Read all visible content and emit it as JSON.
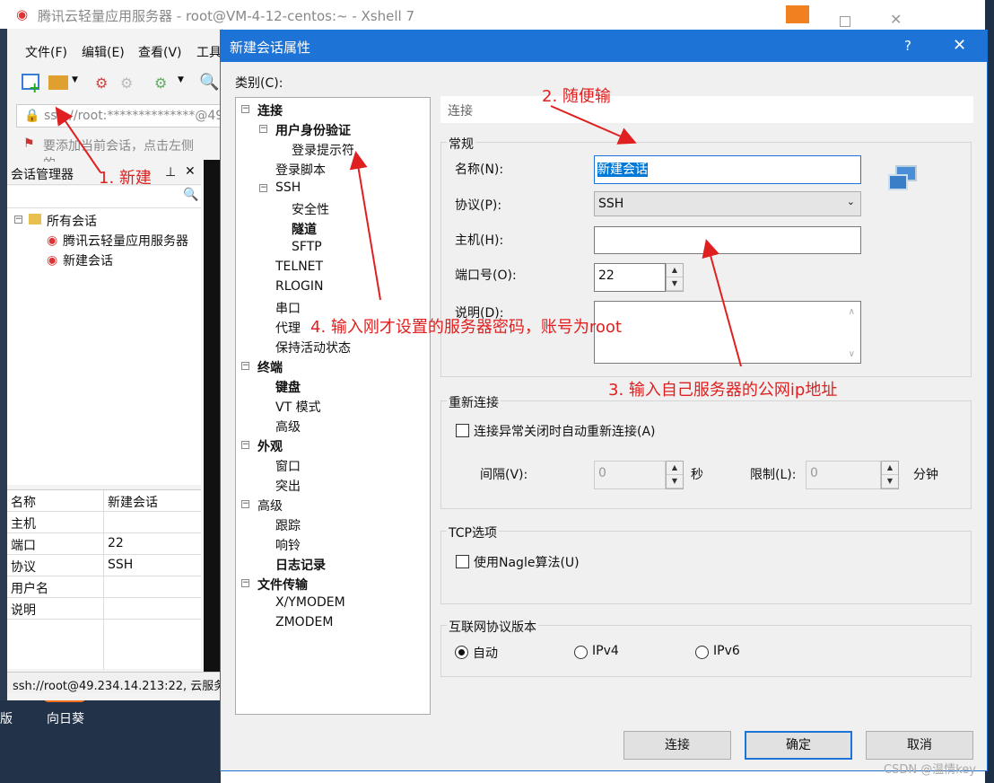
{
  "xshell": {
    "title": "腾讯云轻量应用服务器 - root@VM-4-12-centos:~ - Xshell 7",
    "menu": [
      "文件(F)",
      "编辑(E)",
      "查看(V)",
      "工具"
    ],
    "address": "ssh://root:**************@49",
    "tip": "要添加当前会话，点击左侧的",
    "session_manager": {
      "title": "会话管理器",
      "tree": {
        "root": "所有会话",
        "items": [
          "腾讯云轻量应用服务器",
          "新建会话"
        ]
      },
      "properties": [
        {
          "key": "名称",
          "value": "新建会话"
        },
        {
          "key": "主机",
          "value": ""
        },
        {
          "key": "端口",
          "value": "22"
        },
        {
          "key": "协议",
          "value": "SSH"
        },
        {
          "key": "用户名",
          "value": ""
        },
        {
          "key": "说明",
          "value": ""
        }
      ]
    },
    "status": "ssh://root@49.234.14.213:22, 云服务"
  },
  "desktop": {
    "icon_label_1": "版",
    "icon_label_2": "向日葵"
  },
  "dialog": {
    "title": "新建会话属性",
    "help": "?",
    "category_label": "类别(C):",
    "tree": {
      "connect": "连接",
      "auth": "用户身份验证",
      "login_prompt": "登录提示符",
      "login_script": "登录脚本",
      "ssh": "SSH",
      "security": "安全性",
      "tunnel": "隧道",
      "sftp": "SFTP",
      "telnet": "TELNET",
      "rlogin": "RLOGIN",
      "serial": "串口",
      "proxy": "代理",
      "keepalive": "保持活动状态",
      "terminal": "终端",
      "keyboard": "键盘",
      "vt_mode": "VT 模式",
      "advanced1": "高级",
      "appearance": "外观",
      "window": "窗口",
      "highlight": "突出",
      "advanced": "高级",
      "trace": "跟踪",
      "bell": "响铃",
      "logging": "日志记录",
      "file_transfer": "文件传输",
      "xymodem": "X/YMODEM",
      "zmodem": "ZMODEM"
    },
    "section_header": "连接",
    "general": {
      "label": "常规",
      "name_label": "名称(N):",
      "name_value": "新建会话",
      "protocol_label": "协议(P):",
      "protocol_value": "SSH",
      "host_label": "主机(H):",
      "host_value": "",
      "port_label": "端口号(O):",
      "port_value": "22",
      "desc_label": "说明(D):"
    },
    "reconnect": {
      "label": "重新连接",
      "checkbox": "连接异常关闭时自动重新连接(A)",
      "interval_label": "间隔(V):",
      "interval_value": "0",
      "interval_unit": "秒",
      "limit_label": "限制(L):",
      "limit_value": "0",
      "limit_unit": "分钟"
    },
    "tcp": {
      "label": "TCP选项",
      "checkbox": "使用Nagle算法(U)"
    },
    "ip_version": {
      "label": "互联网协议版本",
      "options": [
        "自动",
        "IPv4",
        "IPv6"
      ],
      "selected": "自动"
    },
    "buttons": {
      "connect": "连接",
      "ok": "确定",
      "cancel": "取消"
    }
  },
  "annotations": {
    "a1": "1. 新建",
    "a2": "2. 随便输",
    "a3": "3. 输入自己服务器的公网ip地址",
    "a4": "4. 输入刚才设置的服务器密码，账号为root"
  },
  "watermark": "CSDN @温情key",
  "colors": {
    "accent": "#1e73d6",
    "annotation": "#e02020"
  }
}
